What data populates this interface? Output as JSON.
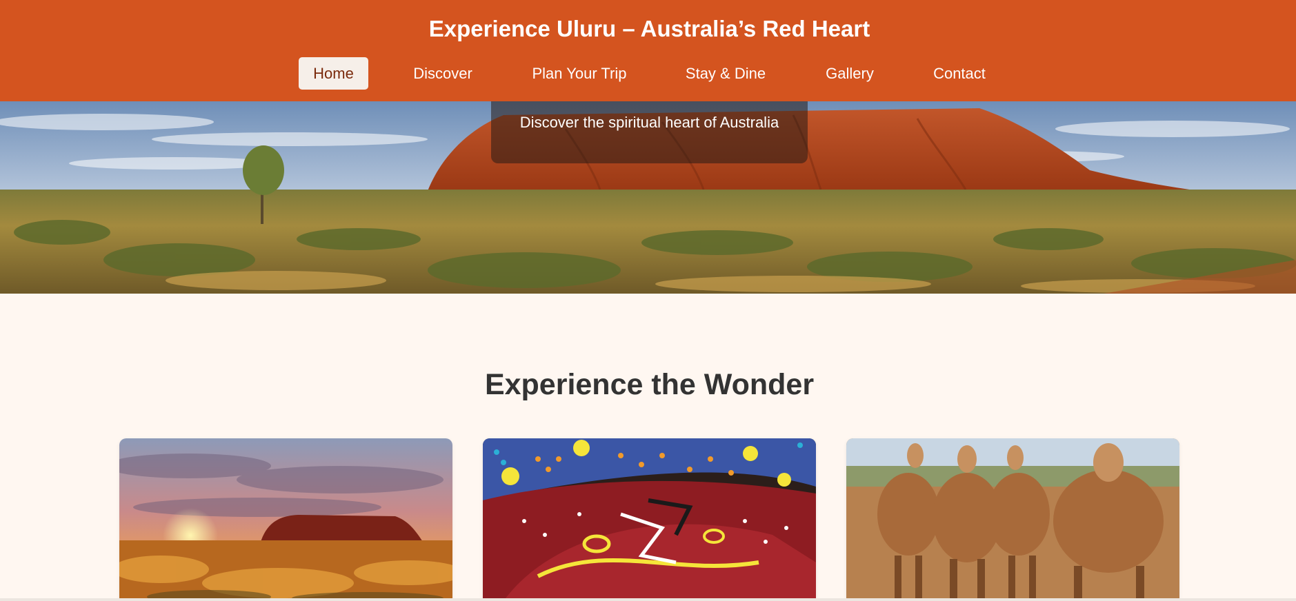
{
  "header": {
    "title": "Experience Uluru – Australia’s Red Heart",
    "background_color": "#d4541f"
  },
  "nav": {
    "items": [
      {
        "label": "Home",
        "active": true
      },
      {
        "label": "Discover",
        "active": false
      },
      {
        "label": "Plan Your Trip",
        "active": false
      },
      {
        "label": "Stay & Dine",
        "active": false
      },
      {
        "label": "Gallery",
        "active": false
      },
      {
        "label": "Contact",
        "active": false
      }
    ]
  },
  "hero": {
    "caption": "Discover the spiritual heart of Australia",
    "image": "uluru-outback-landscape"
  },
  "main": {
    "section_title": "Experience the Wonder",
    "cards": [
      {
        "image": "uluru-sunset-photo"
      },
      {
        "image": "aboriginal-dot-painting-photo"
      },
      {
        "image": "camels-in-desert-photo"
      }
    ]
  },
  "colors": {
    "accent": "#d4541f",
    "page_background": "#fff7f1",
    "heading_text": "#333333",
    "active_nav_background": "#f6efe9"
  }
}
